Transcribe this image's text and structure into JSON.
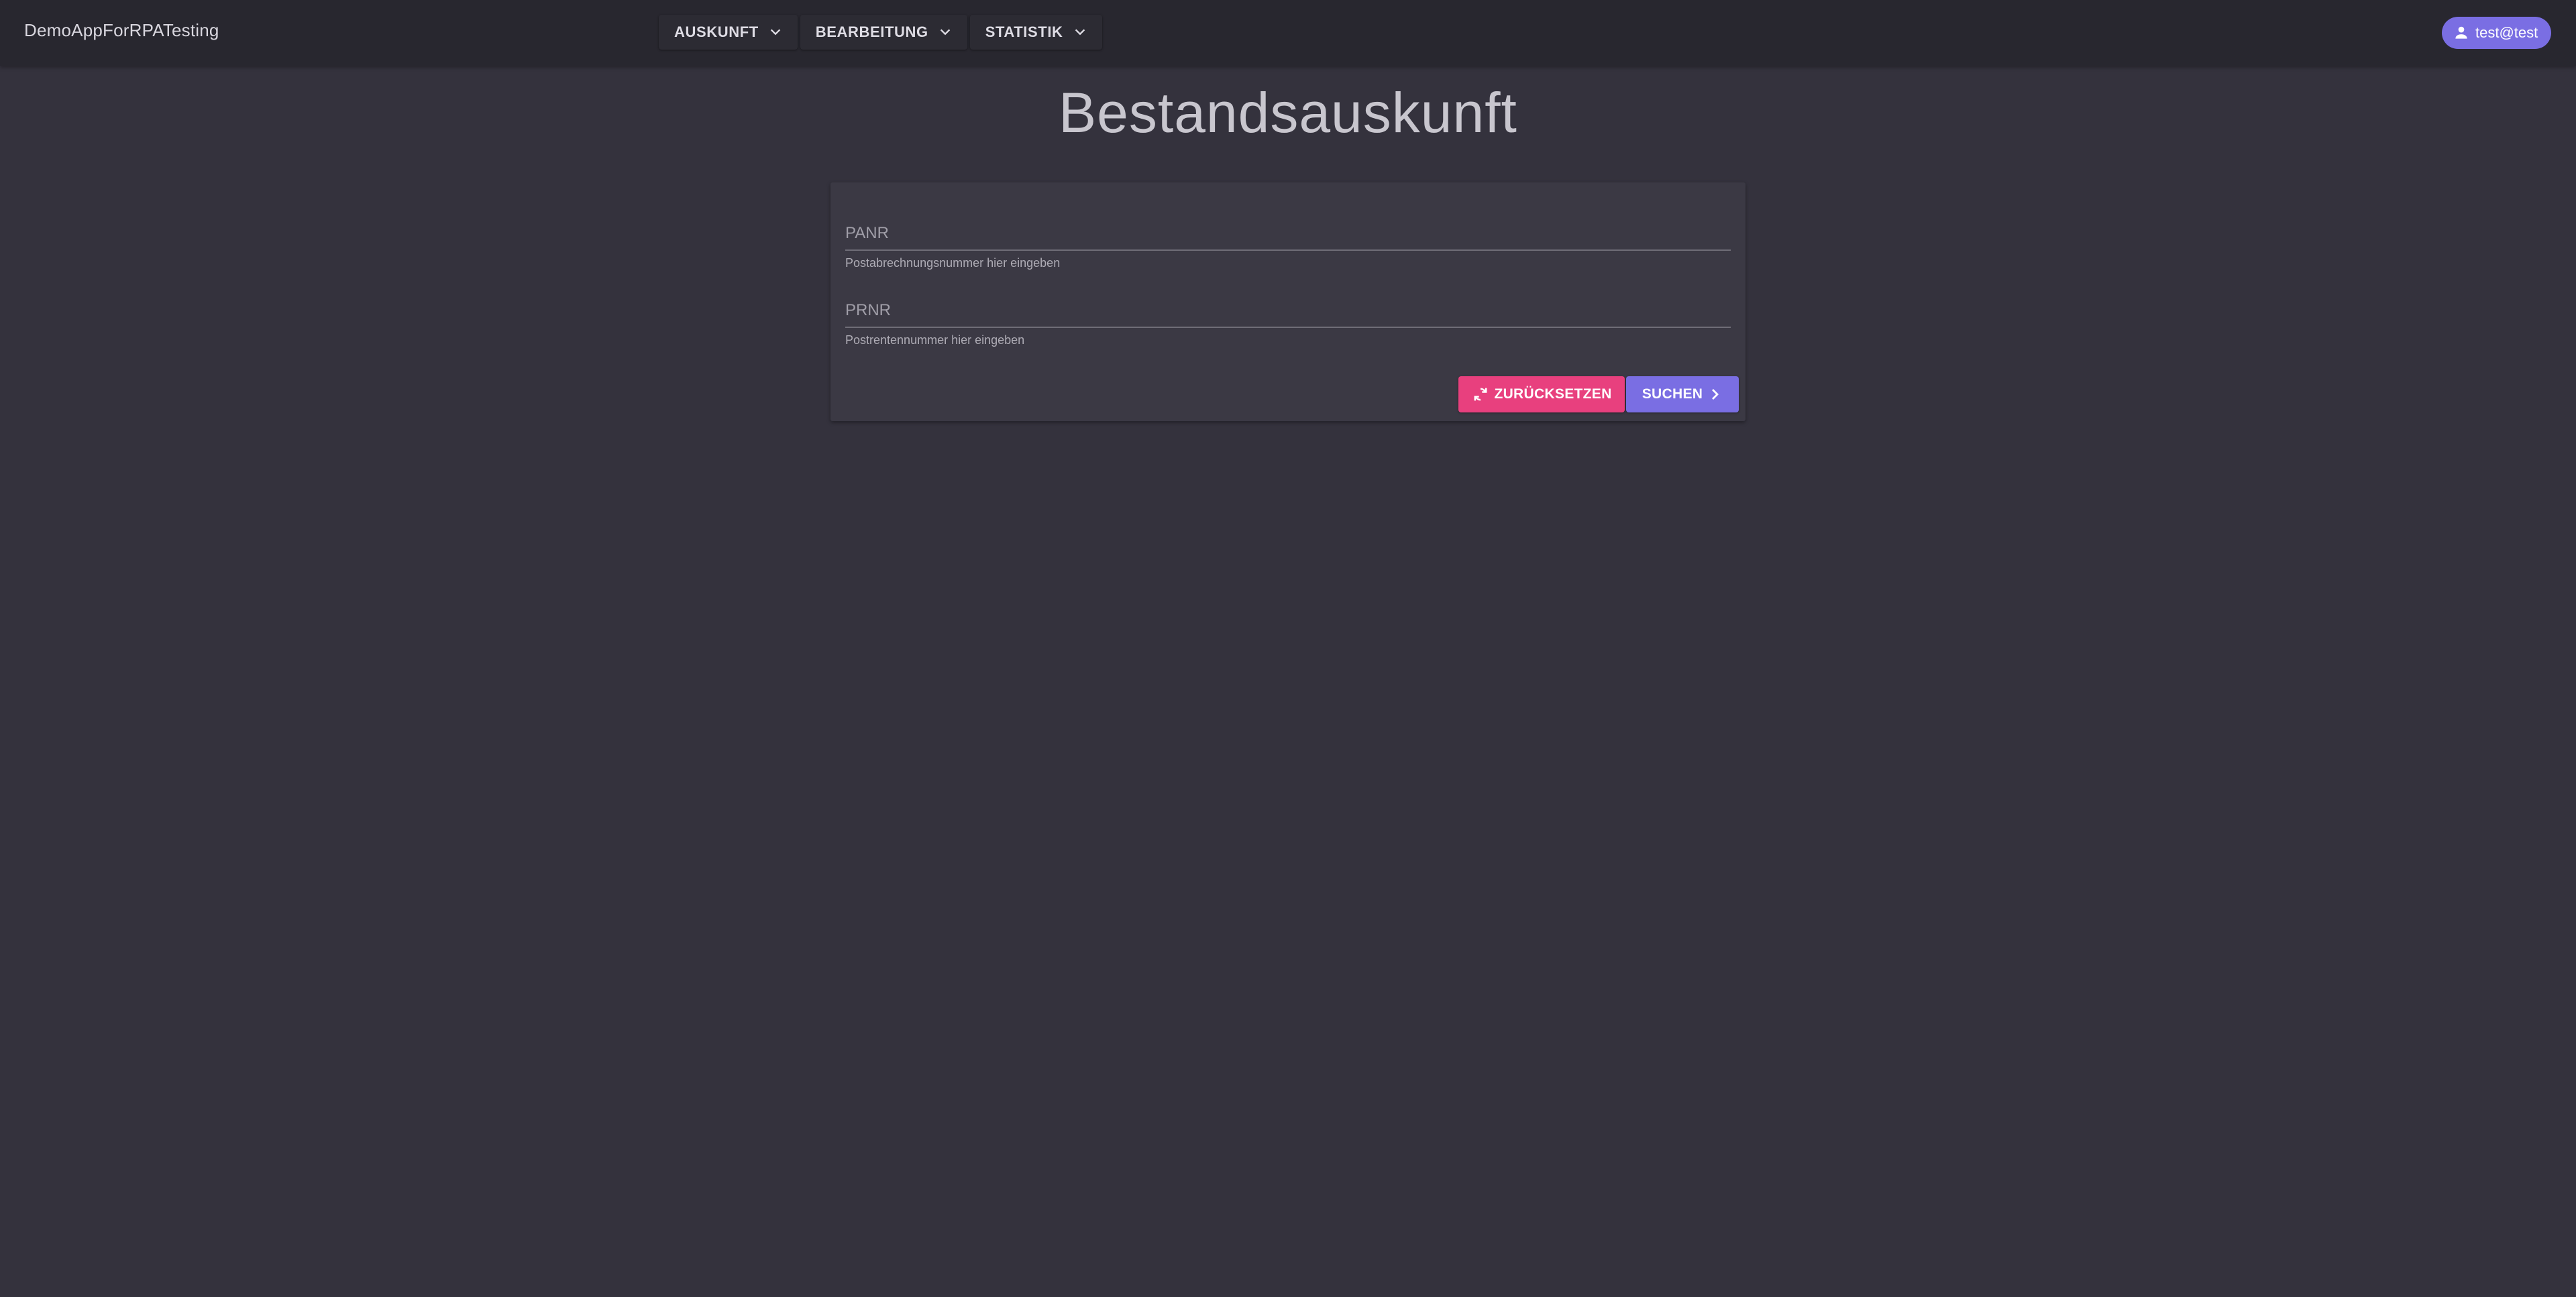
{
  "app": {
    "title": "DemoAppForRPATesting"
  },
  "nav": {
    "items": [
      {
        "label": "AUSKUNFT",
        "icon": "chevron-down-icon"
      },
      {
        "label": "BEARBEITUNG",
        "icon": "chevron-down-icon"
      },
      {
        "label": "STATISTIK",
        "icon": "chevron-down-icon"
      }
    ]
  },
  "user": {
    "name": "test@test",
    "icon": "person-icon"
  },
  "page": {
    "heading": "Bestandsauskunft"
  },
  "form": {
    "panr": {
      "placeholder": "PANR",
      "value": "",
      "hint": "Postabrechnungsnummer hier eingeben"
    },
    "prnr": {
      "placeholder": "PRNR",
      "value": "",
      "hint": "Postrentennummer hier eingeben"
    },
    "reset_label": "ZURÜCKSETZEN",
    "reset_icon": "refresh-icon",
    "search_label": "SUCHEN",
    "search_icon": "chevron-right-icon"
  },
  "colors": {
    "background": "#34323d",
    "topbar": "#28272f",
    "card": "#3b3944",
    "accent": "#7a6ee3",
    "reset": "#e8407e"
  }
}
